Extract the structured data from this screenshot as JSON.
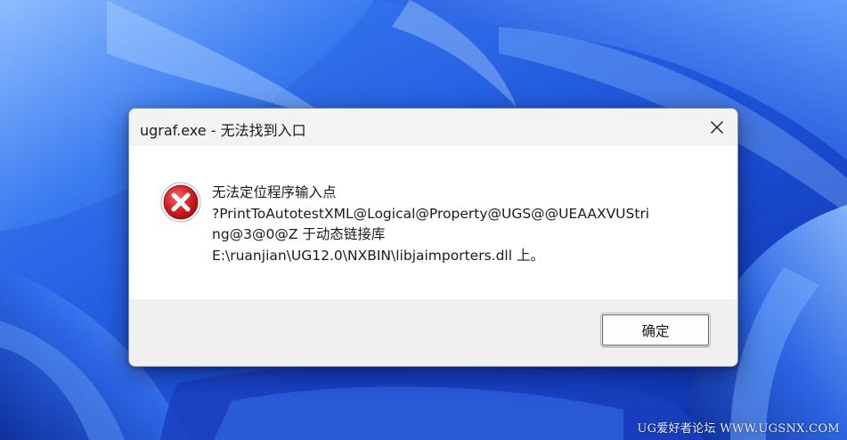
{
  "dialog": {
    "title": "ugraf.exe - 无法找到入口",
    "close_icon": "close-icon",
    "error_icon": "error-icon",
    "message_lines": [
      "无法定位程序输入点",
      "?PrintToAutotestXML@Logical@Property@UGS@@UEAAXVUStri",
      "ng@3@0@Z 于动态链接库",
      "E:\\ruanjian\\UG12.0\\NXBIN\\libjaimporters.dll 上。"
    ],
    "ok_label": "确定"
  },
  "watermark": {
    "text": "UG爱好者论坛 WWW.UGSNX.COM"
  },
  "colors": {
    "wallpaper_base": "#2a63e4",
    "error_red": "#c8181c",
    "dialog_bg": "#ffffff",
    "footer_bg": "#f0f0f0"
  }
}
